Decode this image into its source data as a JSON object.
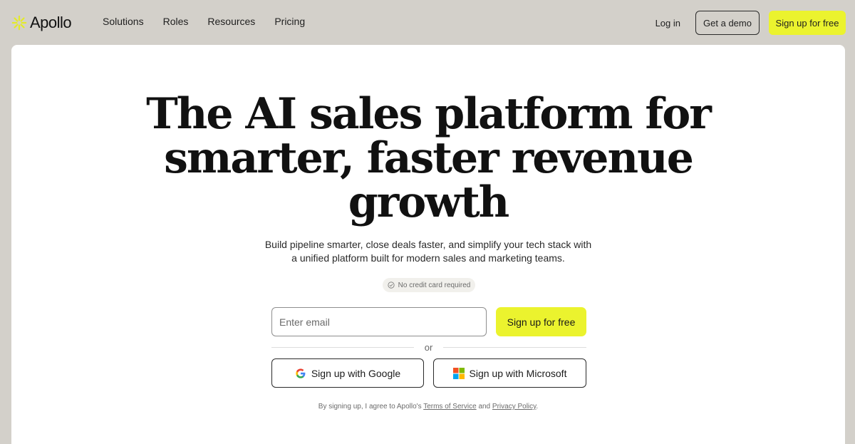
{
  "brand": {
    "name": "Apollo",
    "accent": "#ebf32e",
    "logo_icon": "apollo-logo-icon"
  },
  "nav": {
    "items": [
      {
        "label": "Solutions"
      },
      {
        "label": "Roles"
      },
      {
        "label": "Resources"
      },
      {
        "label": "Pricing"
      }
    ]
  },
  "header_actions": {
    "login_label": "Log in",
    "demo_label": "Get a demo",
    "signup_label": "Sign up for free"
  },
  "hero": {
    "title_lines": [
      "The AI sales platform for",
      "smarter, faster revenue",
      "growth"
    ],
    "subtitle_lines": [
      "Build pipeline smarter, close deals faster, and simplify your tech stack with",
      "a unified platform built for modern sales and marketing teams."
    ],
    "badge": "No credit card required"
  },
  "signup_form": {
    "email_placeholder": "Enter email",
    "email_value": "",
    "submit_label": "Sign up for free",
    "or_label": "or",
    "google_label": "Sign up with Google",
    "microsoft_label": "Sign up with Microsoft"
  },
  "terms": {
    "prefix": "By signing up, I agree to Apollo's",
    "tos_label": "Terms of Service",
    "and": "and",
    "privacy_label": "Privacy Policy",
    "suffix": "."
  }
}
